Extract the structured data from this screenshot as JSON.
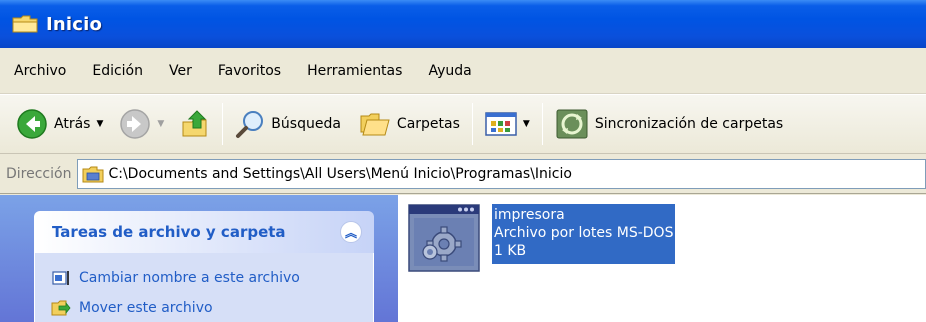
{
  "window": {
    "title": "Inicio"
  },
  "menu": [
    "Archivo",
    "Edición",
    "Ver",
    "Favoritos",
    "Herramientas",
    "Ayuda"
  ],
  "toolbar": {
    "back_label": "Atrás",
    "search_label": "Búsqueda",
    "folders_label": "Carpetas",
    "sync_label": "Sincronización de carpetas"
  },
  "address": {
    "label": "Dirección",
    "path": "C:\\Documents and Settings\\All Users\\Menú Inicio\\Programas\\Inicio"
  },
  "tasks": {
    "title": "Tareas de archivo y carpeta",
    "items": [
      "Cambiar nombre a este archivo",
      "Mover este archivo"
    ]
  },
  "file": {
    "name": "impresora",
    "type": "Archivo por lotes MS-DOS",
    "size": "1 KB",
    "selected": true
  },
  "colors": {
    "titlebar": "#0054e3",
    "selection": "#316ac5",
    "task_link": "#215dc6"
  }
}
